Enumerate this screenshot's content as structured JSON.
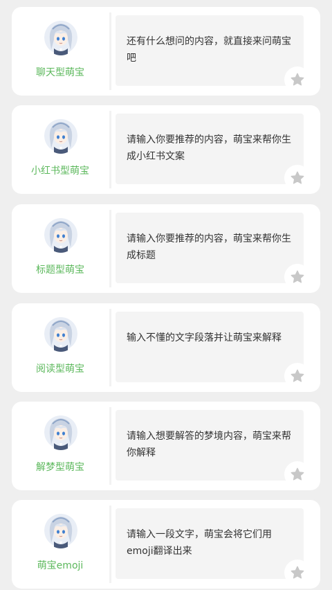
{
  "bots": [
    {
      "name": "聊天型萌宝",
      "description": "还有什么想问的内容，就直接来问萌宝吧",
      "avatar_icon": "anime-girl-avatar-icon",
      "favorite_icon": "star-icon"
    },
    {
      "name": "小红书型萌宝",
      "description": "请输入你要推荐的内容，萌宝来帮你生成小红书文案",
      "avatar_icon": "anime-girl-avatar-icon",
      "favorite_icon": "star-icon"
    },
    {
      "name": "标题型萌宝",
      "description": "请输入你要推荐的内容，萌宝来帮你生成标题",
      "avatar_icon": "anime-girl-avatar-icon",
      "favorite_icon": "star-icon"
    },
    {
      "name": "阅读型萌宝",
      "description": "输入不懂的文字段落并让萌宝来解释",
      "avatar_icon": "anime-girl-avatar-icon",
      "favorite_icon": "star-icon"
    },
    {
      "name": "解梦型萌宝",
      "description": "请输入想要解答的梦境内容，萌宝来帮你解释",
      "avatar_icon": "anime-girl-avatar-icon",
      "favorite_icon": "star-icon"
    },
    {
      "name": "萌宝emoji",
      "description": "请输入一段文字，萌宝会将它们用emoji翻译出来",
      "avatar_icon": "anime-girl-avatar-icon",
      "favorite_icon": "star-icon"
    }
  ],
  "colors": {
    "page_background": "#efefef",
    "card_background": "#ffffff",
    "name_green": "#5cb85c",
    "star_gray": "#c8c8c8",
    "desc_box": "#f4f4f4"
  }
}
